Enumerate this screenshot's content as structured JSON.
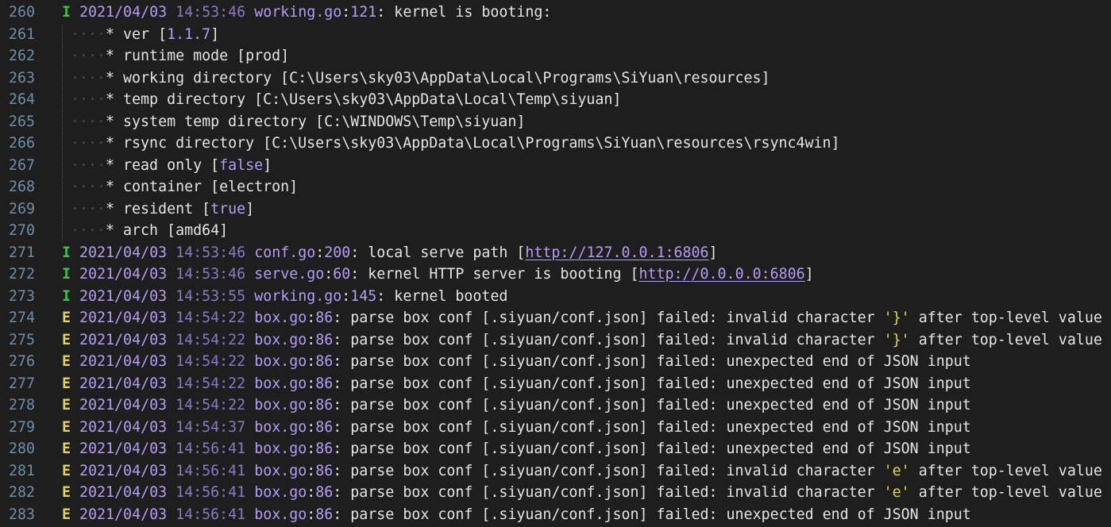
{
  "editor": {
    "lines": [
      {
        "no": "260",
        "kind": "log",
        "level": "I",
        "date": "2021/04/03",
        "time": "14:53:46",
        "file": "working.go",
        "lineno": "121",
        "msg": ": kernel is booting:"
      },
      {
        "no": "261",
        "kind": "sub",
        "text": "* ver [",
        "val": "1.1.7",
        "tail": "]"
      },
      {
        "no": "262",
        "kind": "sub",
        "text": "* runtime mode [prod]",
        "val": "",
        "tail": ""
      },
      {
        "no": "263",
        "kind": "sub",
        "text": "* working directory [C:\\Users\\sky03\\AppData\\Local\\Programs\\SiYuan\\resources]",
        "val": "",
        "tail": ""
      },
      {
        "no": "264",
        "kind": "sub",
        "text": "* temp directory [C:\\Users\\sky03\\AppData\\Local\\Temp\\siyuan]",
        "val": "",
        "tail": ""
      },
      {
        "no": "265",
        "kind": "sub",
        "text": "* system temp directory [C:\\WINDOWS\\Temp\\siyuan]",
        "val": "",
        "tail": ""
      },
      {
        "no": "266",
        "kind": "sub",
        "text": "* rsync directory [C:\\Users\\sky03\\AppData\\Local\\Programs\\SiYuan\\resources\\rsync4win]",
        "val": "",
        "tail": ""
      },
      {
        "no": "267",
        "kind": "sub",
        "text": "* read only [",
        "val": "false",
        "tail": "]"
      },
      {
        "no": "268",
        "kind": "sub",
        "text": "* container [electron]",
        "val": "",
        "tail": ""
      },
      {
        "no": "269",
        "kind": "sub",
        "text": "* resident [",
        "val": "true",
        "tail": "]"
      },
      {
        "no": "270",
        "kind": "sub",
        "text": "* arch [amd64]",
        "val": "",
        "tail": ""
      },
      {
        "no": "271",
        "kind": "log",
        "level": "I",
        "date": "2021/04/03",
        "time": "14:53:46",
        "file": "conf.go",
        "lineno": "200",
        "msg": ": local serve path [",
        "link": "http://127.0.0.1:6806",
        "tail": "]"
      },
      {
        "no": "272",
        "kind": "log",
        "level": "I",
        "date": "2021/04/03",
        "time": "14:53:46",
        "file": "serve.go",
        "lineno": "60",
        "msg": ": kernel HTTP server is booting [",
        "link": "http://0.0.0.0:6806",
        "tail": "]"
      },
      {
        "no": "273",
        "kind": "log",
        "level": "I",
        "date": "2021/04/03",
        "time": "14:53:55",
        "file": "working.go",
        "lineno": "145",
        "msg": ": kernel booted"
      },
      {
        "no": "274",
        "kind": "log",
        "level": "E",
        "date": "2021/04/03",
        "time": "14:54:22",
        "file": "box.go",
        "lineno": "86",
        "msg": ": parse box conf [.siyuan/conf.json] failed: invalid character ",
        "str": "'}'",
        "tail": " after top-level value"
      },
      {
        "no": "275",
        "kind": "log",
        "level": "E",
        "date": "2021/04/03",
        "time": "14:54:22",
        "file": "box.go",
        "lineno": "86",
        "msg": ": parse box conf [.siyuan/conf.json] failed: invalid character ",
        "str": "'}'",
        "tail": " after top-level value"
      },
      {
        "no": "276",
        "kind": "log",
        "level": "E",
        "date": "2021/04/03",
        "time": "14:54:22",
        "file": "box.go",
        "lineno": "86",
        "msg": ": parse box conf [.siyuan/conf.json] failed: unexpected end of JSON input"
      },
      {
        "no": "277",
        "kind": "log",
        "level": "E",
        "date": "2021/04/03",
        "time": "14:54:22",
        "file": "box.go",
        "lineno": "86",
        "msg": ": parse box conf [.siyuan/conf.json] failed: unexpected end of JSON input"
      },
      {
        "no": "278",
        "kind": "log",
        "level": "E",
        "date": "2021/04/03",
        "time": "14:54:22",
        "file": "box.go",
        "lineno": "86",
        "msg": ": parse box conf [.siyuan/conf.json] failed: unexpected end of JSON input"
      },
      {
        "no": "279",
        "kind": "log",
        "level": "E",
        "date": "2021/04/03",
        "time": "14:54:37",
        "file": "box.go",
        "lineno": "86",
        "msg": ": parse box conf [.siyuan/conf.json] failed: unexpected end of JSON input"
      },
      {
        "no": "280",
        "kind": "log",
        "level": "E",
        "date": "2021/04/03",
        "time": "14:56:41",
        "file": "box.go",
        "lineno": "86",
        "msg": ": parse box conf [.siyuan/conf.json] failed: unexpected end of JSON input"
      },
      {
        "no": "281",
        "kind": "log",
        "level": "E",
        "date": "2021/04/03",
        "time": "14:56:41",
        "file": "box.go",
        "lineno": "86",
        "msg": ": parse box conf [.siyuan/conf.json] failed: invalid character ",
        "str": "'e'",
        "tail": " after top-level value"
      },
      {
        "no": "282",
        "kind": "log",
        "level": "E",
        "date": "2021/04/03",
        "time": "14:56:41",
        "file": "box.go",
        "lineno": "86",
        "msg": ": parse box conf [.siyuan/conf.json] failed: invalid character ",
        "str": "'e'",
        "tail": " after top-level value"
      },
      {
        "no": "283",
        "kind": "log",
        "level": "E",
        "date": "2021/04/03",
        "time": "14:56:41",
        "file": "box.go",
        "lineno": "86",
        "msg": ": parse box conf [.siyuan/conf.json] failed: unexpected end of JSON input"
      }
    ]
  },
  "colors": {
    "background": "#1e1e1e",
    "info_level": "#3fbf4f",
    "error_level": "#e3d253",
    "accent": "#b59cf5"
  }
}
